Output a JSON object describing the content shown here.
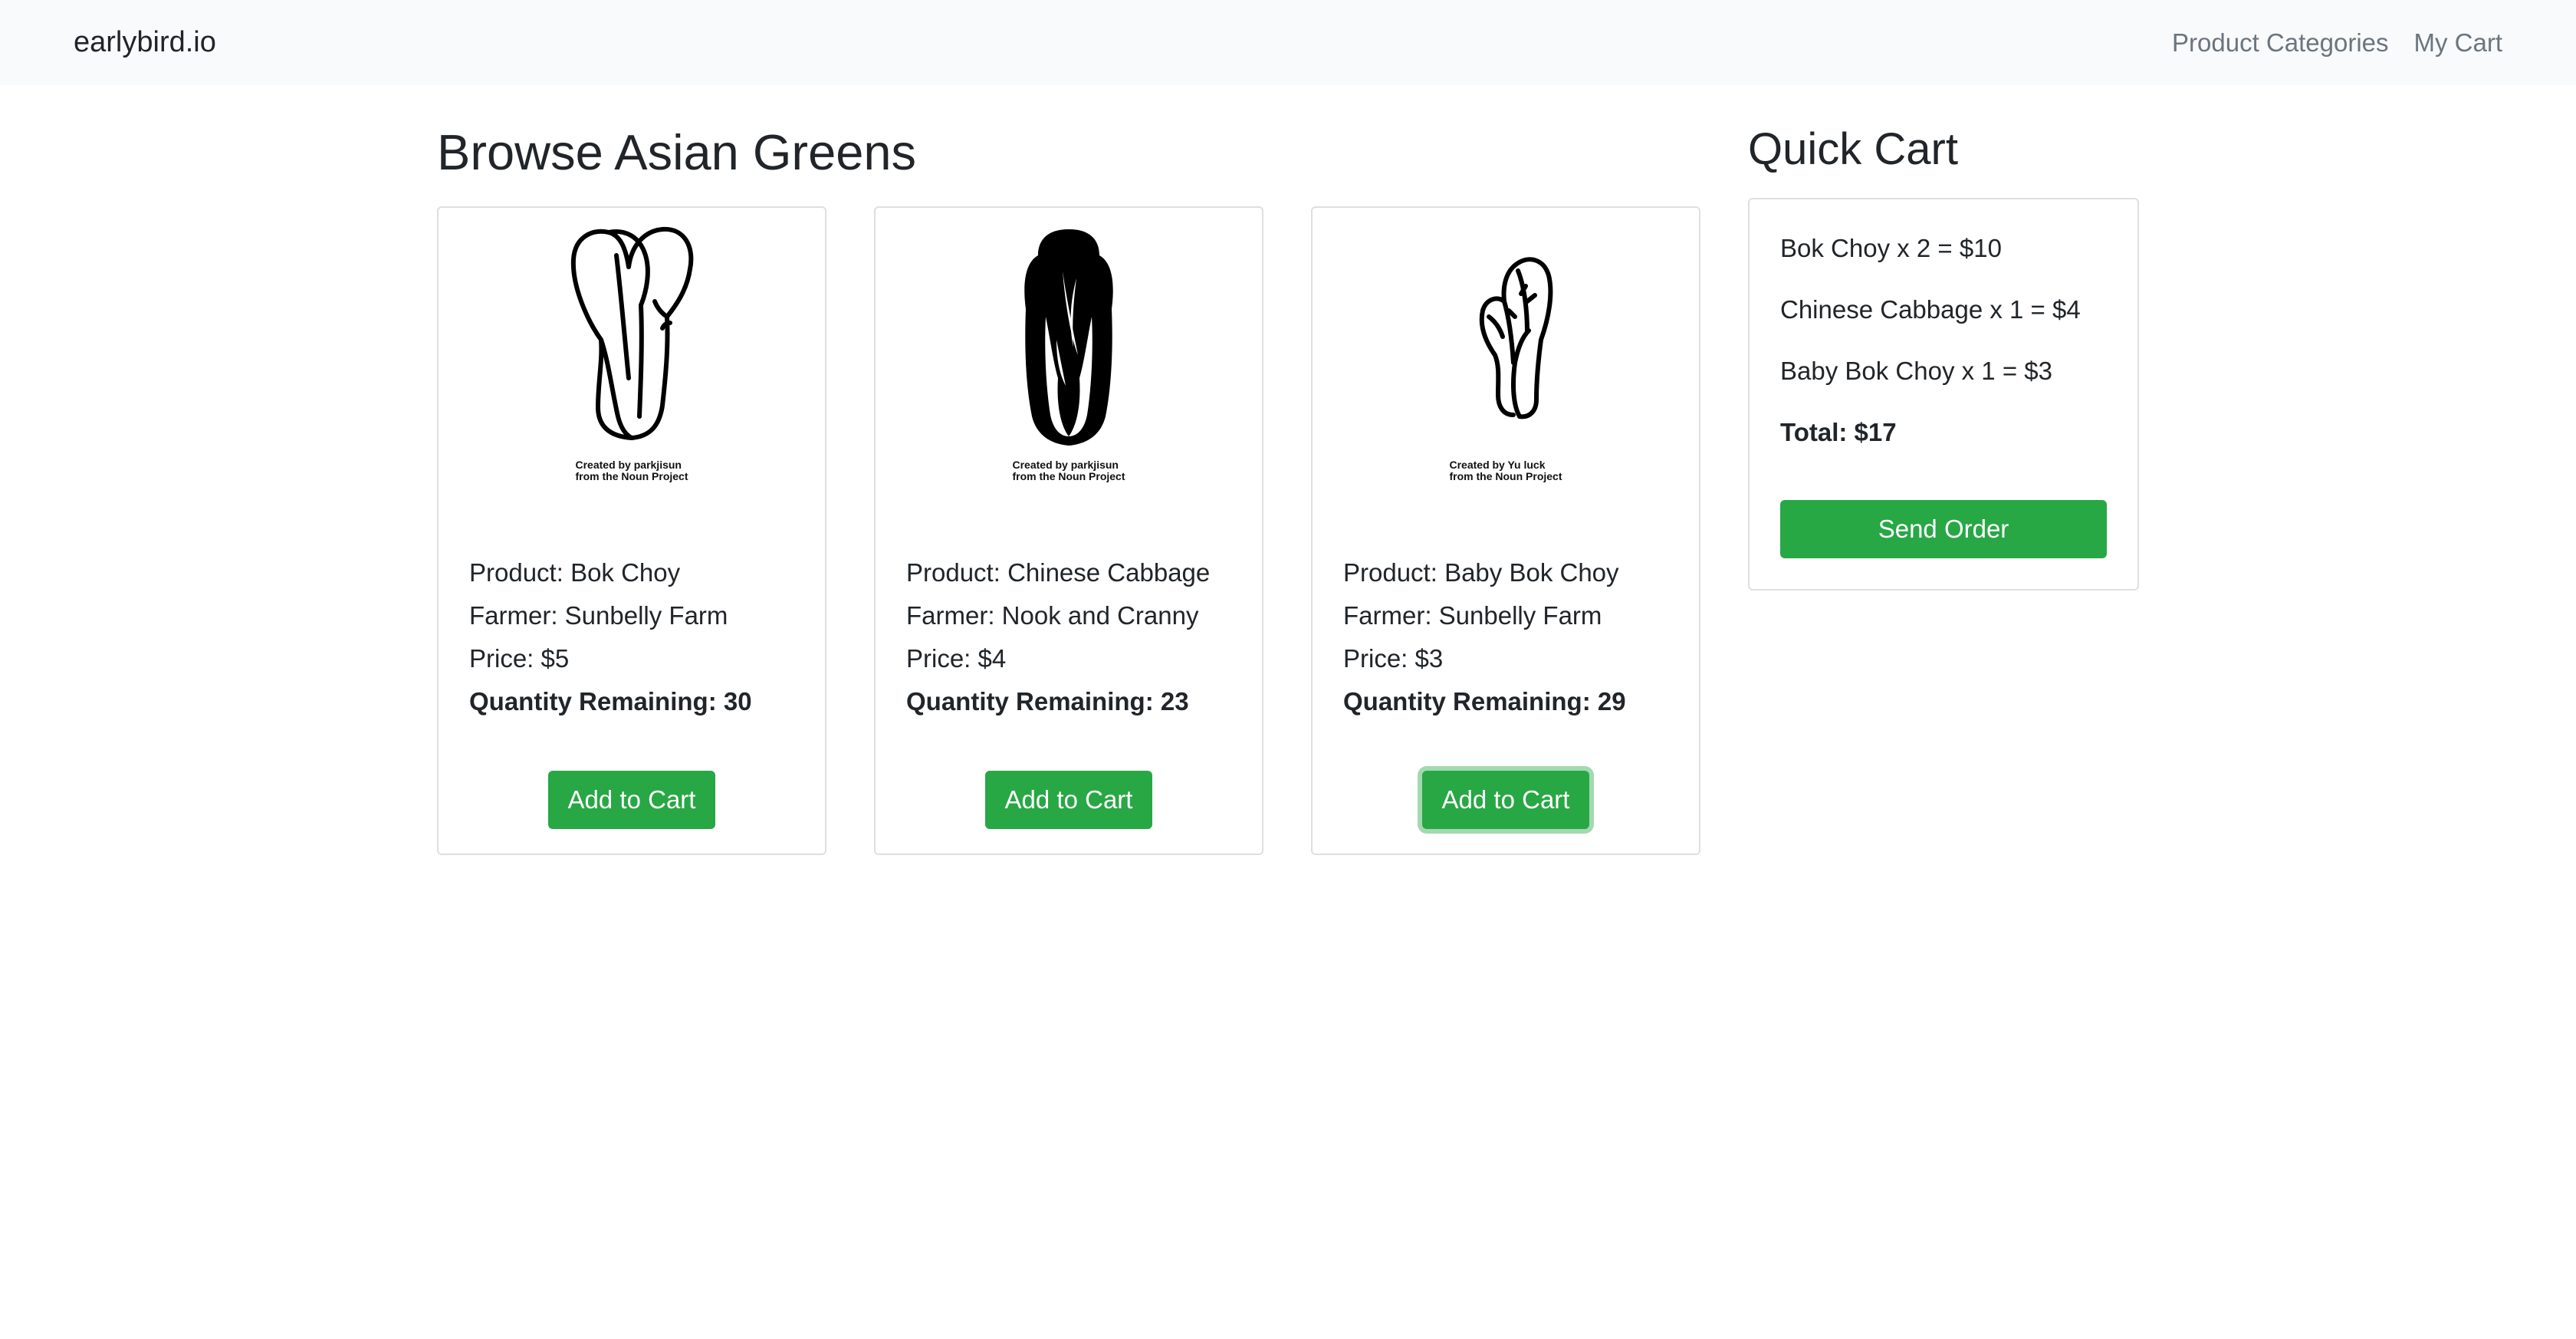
{
  "navbar": {
    "brand": "earlybird.io",
    "links": [
      "Product Categories",
      "My Cart"
    ]
  },
  "page": {
    "title": "Browse Asian Greens"
  },
  "products": [
    {
      "product_label": "Product: Bok Choy",
      "farmer_label": "Farmer: Sunbelly Farm",
      "price_label": "Price: $5",
      "quantity_label": "Quantity Remaining: 30",
      "credit_line1": "Created by parkjisun",
      "credit_line2": "from the Noun Project",
      "button": "Add to Cart",
      "icon": "bok-choy-icon"
    },
    {
      "product_label": "Product: Chinese Cabbage",
      "farmer_label": "Farmer: Nook and Cranny",
      "price_label": "Price: $4",
      "quantity_label": "Quantity Remaining: 23",
      "credit_line1": "Created by parkjisun",
      "credit_line2": "from the Noun Project",
      "button": "Add to Cart",
      "icon": "chinese-cabbage-icon"
    },
    {
      "product_label": "Product: Baby Bok Choy",
      "farmer_label": "Farmer: Sunbelly Farm",
      "price_label": "Price: $3",
      "quantity_label": "Quantity Remaining: 29",
      "credit_line1": "Created by Yu luck",
      "credit_line2": "from the Noun Project",
      "button": "Add to Cart",
      "icon": "baby-bok-choy-icon"
    }
  ],
  "quick_cart": {
    "title": "Quick Cart",
    "items": [
      "Bok Choy x 2 = $10",
      "Chinese Cabbage x 1 = $4",
      "Baby Bok Choy x 1 = $3"
    ],
    "total": "Total: $17",
    "send_button": "Send Order"
  },
  "colors": {
    "accent_green": "#28a745",
    "navbar_bg": "#f8fafc",
    "nav_link": "#6c757d"
  }
}
